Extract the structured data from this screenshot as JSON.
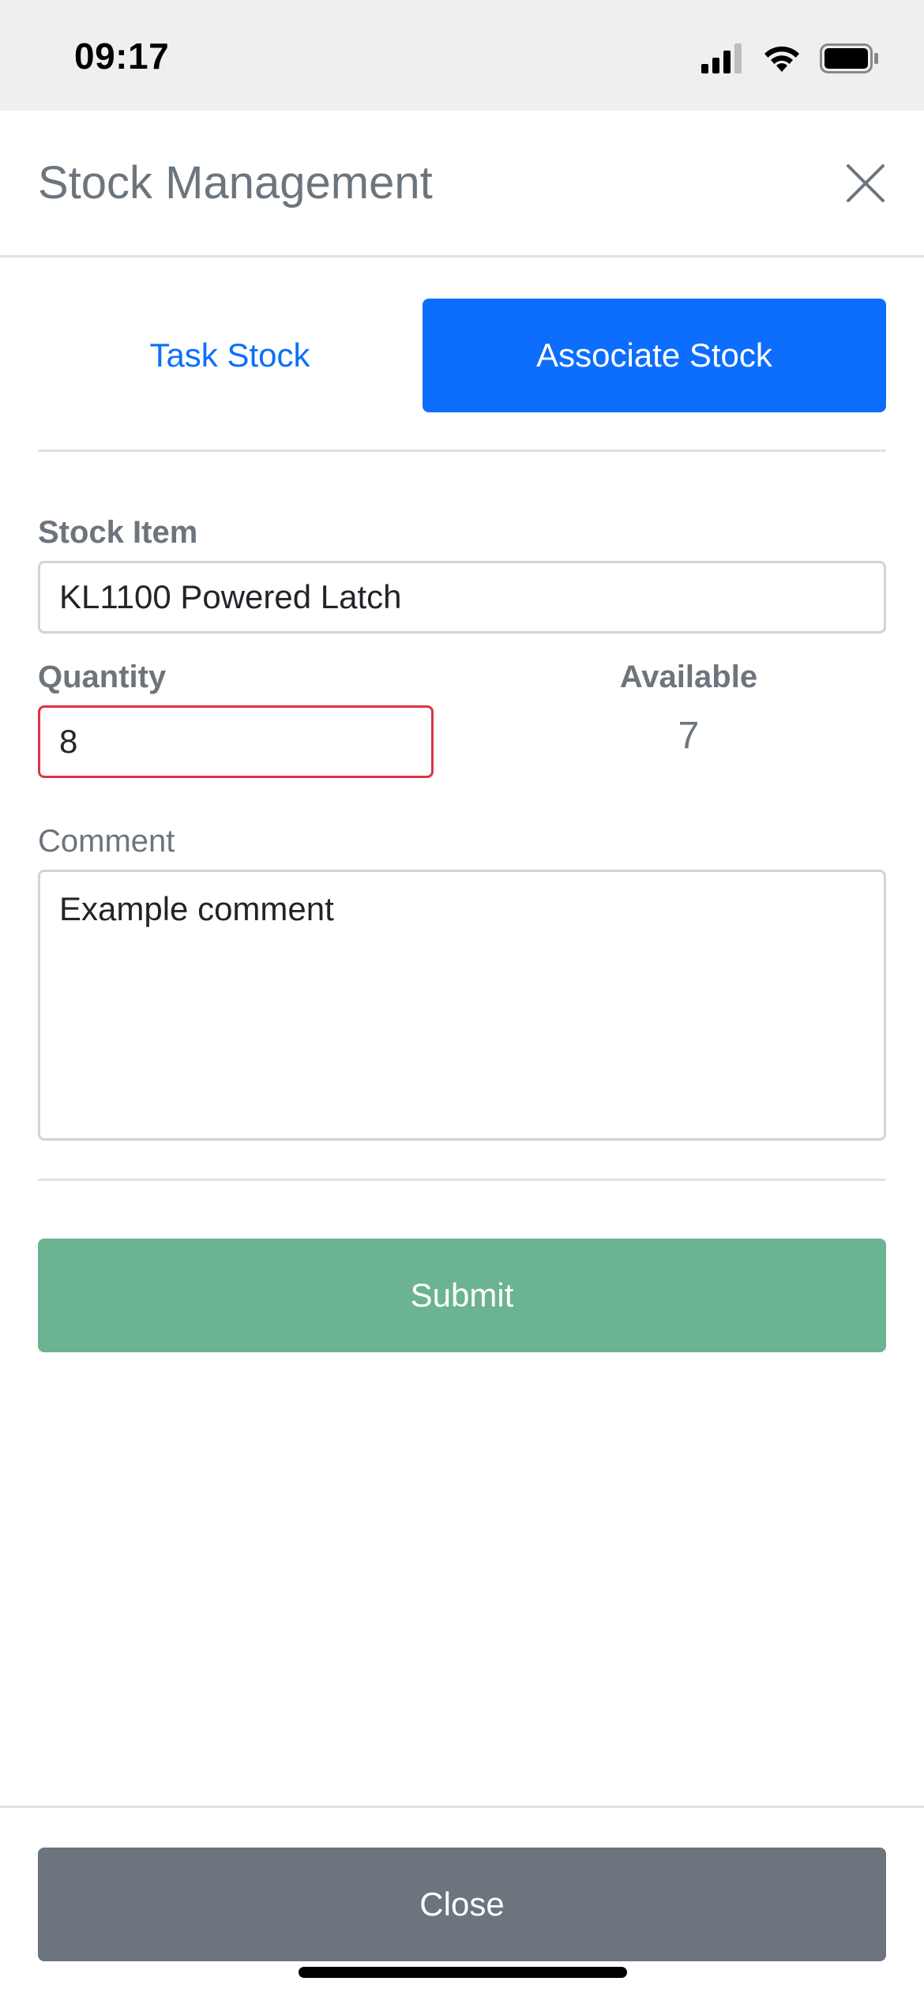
{
  "status_bar": {
    "time": "09:17",
    "icons": [
      "signal-icon",
      "wifi-icon",
      "battery-icon"
    ]
  },
  "header": {
    "title": "Stock Management",
    "close_icon": "close-icon"
  },
  "tabs": [
    {
      "label": "Task Stock",
      "active": false
    },
    {
      "label": "Associate Stock",
      "active": true
    }
  ],
  "form": {
    "stock_item": {
      "label": "Stock Item",
      "value": "KL1100 Powered Latch"
    },
    "quantity": {
      "label": "Quantity",
      "value": "8"
    },
    "available": {
      "label": "Available",
      "value": "7"
    },
    "comment": {
      "label": "Comment",
      "value": "Example comment"
    }
  },
  "actions": {
    "submit_label": "Submit",
    "close_label": "Close"
  },
  "colors": {
    "primary": "#0d6efd",
    "submit": "#6bb391",
    "close": "#6c757d",
    "invalid": "#dc3545"
  }
}
